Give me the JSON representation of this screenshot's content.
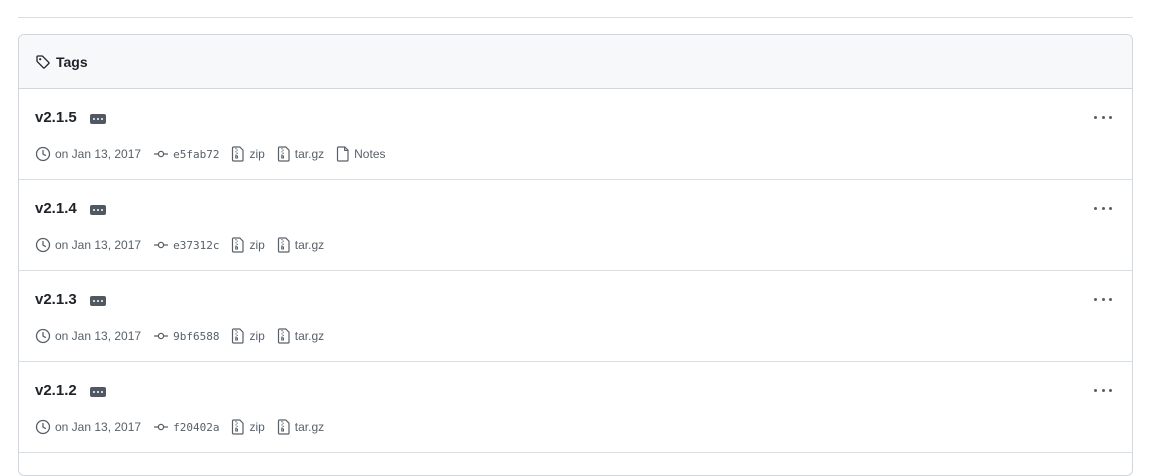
{
  "header": {
    "title": "Tags",
    "icon": "tag-icon"
  },
  "colors": {
    "text": "#1f2328",
    "muted": "#57606a",
    "border": "#d0d7de",
    "header_bg": "#f6f8fa",
    "badge": "#505961"
  },
  "tags": [
    {
      "name": "v2.1.5",
      "date": "on Jan 13, 2017",
      "sha": "e5fab72",
      "zip": "zip",
      "targz": "tar.gz",
      "notes": "Notes"
    },
    {
      "name": "v2.1.4",
      "date": "on Jan 13, 2017",
      "sha": "e37312c",
      "zip": "zip",
      "targz": "tar.gz"
    },
    {
      "name": "v2.1.3",
      "date": "on Jan 13, 2017",
      "sha": "9bf6588",
      "zip": "zip",
      "targz": "tar.gz"
    },
    {
      "name": "v2.1.2",
      "date": "on Jan 13, 2017",
      "sha": "f20402a",
      "zip": "zip",
      "targz": "tar.gz"
    }
  ]
}
